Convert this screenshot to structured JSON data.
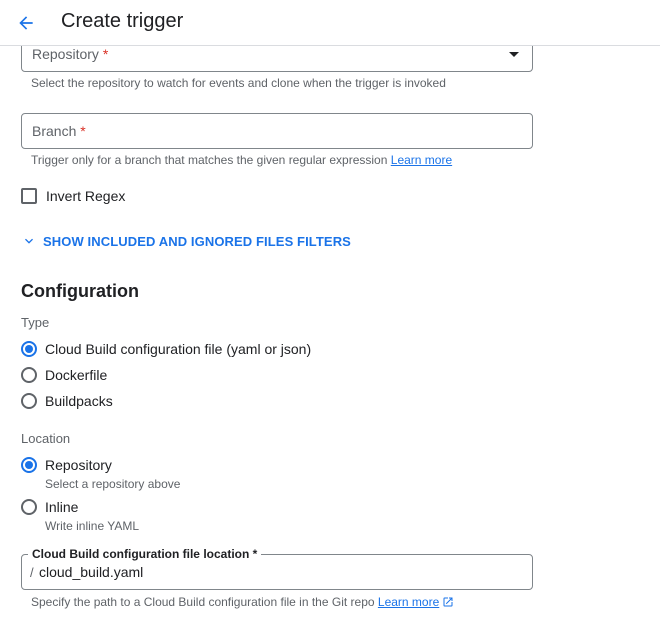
{
  "header": {
    "title": "Create trigger",
    "back_icon": "arrow-back-icon"
  },
  "repository": {
    "label": "Repository",
    "required_mark": "*",
    "hint": "Select the repository to watch for events and clone when the trigger is invoked"
  },
  "branch": {
    "label": "Branch",
    "required_mark": "*",
    "hint": "Trigger only for a branch that matches the given regular expression",
    "learn_more": "Learn more"
  },
  "invert_regex": {
    "label": "Invert Regex",
    "checked": false
  },
  "filters_toggle": {
    "label": "SHOW INCLUDED AND IGNORED FILES FILTERS",
    "icon": "chevron-down-icon"
  },
  "configuration": {
    "title": "Configuration",
    "type_label": "Type",
    "type_options": [
      {
        "label": "Cloud Build configuration file (yaml or json)",
        "selected": true
      },
      {
        "label": "Dockerfile",
        "selected": false
      },
      {
        "label": "Buildpacks",
        "selected": false
      }
    ],
    "location_label": "Location",
    "location_options": [
      {
        "label": "Repository",
        "sub": "Select a repository above",
        "selected": true
      },
      {
        "label": "Inline",
        "sub": "Write inline YAML",
        "selected": false
      }
    ],
    "file_location": {
      "label": "Cloud Build configuration file location *",
      "prefix": "/",
      "value": "cloud_build.yaml",
      "hint": "Specify the path to a Cloud Build configuration file in the Git repo",
      "learn_more": "Learn more",
      "link_icon": "open-in-new-icon"
    }
  },
  "colors": {
    "accent": "#1a73e8",
    "required": "#d93025",
    "text": "#202124",
    "muted": "#5f6368"
  }
}
